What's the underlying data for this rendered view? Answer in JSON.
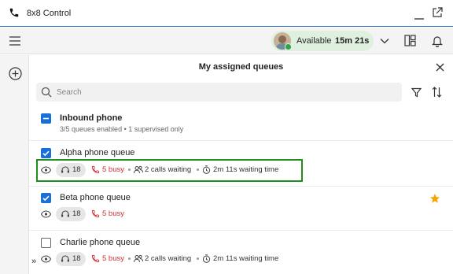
{
  "window": {
    "title": "8x8 Control"
  },
  "header": {
    "status": {
      "label": "Available",
      "timer": "15m 21s",
      "color": "#2fa34a"
    }
  },
  "panel": {
    "title": "My assigned queues",
    "search": {
      "placeholder": "Search",
      "value": ""
    },
    "group": {
      "name": "Inbound phone",
      "subtitle": "3/5 queues enabled • 1 supervised only"
    },
    "queues": [
      {
        "name": "Alpha phone queue",
        "checked": true,
        "agents": "18",
        "busy": "5 busy",
        "calls_waiting": "2 calls waiting",
        "waiting_time": "2m 11s waiting time",
        "favorite": false,
        "highlighted": true
      },
      {
        "name": "Beta phone queue",
        "checked": true,
        "agents": "18",
        "busy": "5 busy",
        "favorite": true
      },
      {
        "name": "Charlie phone queue",
        "checked": false,
        "agents": "18",
        "busy": "5 busy",
        "calls_waiting": "2 calls waiting",
        "waiting_time": "2m 11s waiting time",
        "favorite": false
      }
    ],
    "expand_label": "»"
  },
  "colors": {
    "accent": "#1a6ed8",
    "busy": "#d32f2f",
    "highlight_border": "#1e8f1e",
    "star": "#f0a500"
  },
  "icons": [
    "phone-icon",
    "minimize-icon",
    "popout-icon",
    "menu-icon",
    "chevron-down-icon",
    "layout-icon",
    "bell-icon",
    "add-icon",
    "close-icon",
    "search-icon",
    "filter-icon",
    "sort-icon",
    "eye-icon",
    "headset-icon",
    "phone-busy-icon",
    "calls-waiting-icon",
    "timer-icon",
    "star-icon"
  ]
}
